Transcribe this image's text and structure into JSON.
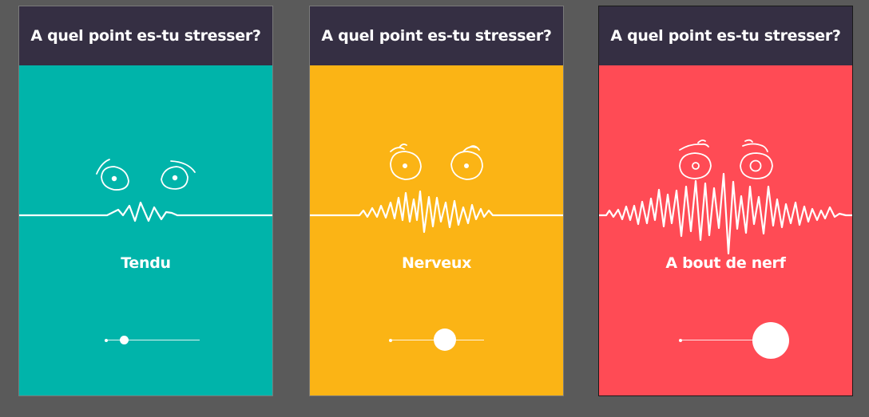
{
  "cards": [
    {
      "title": "A quel point es-tu stresser?",
      "mood": "Tendu",
      "color": "#00b4aa",
      "stress_level": 0.2,
      "face": "tense-face-icon"
    },
    {
      "title": "A quel point es-tu stresser?",
      "mood": "Nerveux",
      "color": "#fbb415",
      "stress_level": 0.58,
      "face": "nervous-face-icon"
    },
    {
      "title": "A quel point es-tu stresser?",
      "mood": "A bout de nerf",
      "color": "#ff4b55",
      "stress_level": 1.0,
      "face": "stressed-out-face-icon"
    }
  ],
  "header_color": "#352f43",
  "background_color": "#5a5a5a"
}
